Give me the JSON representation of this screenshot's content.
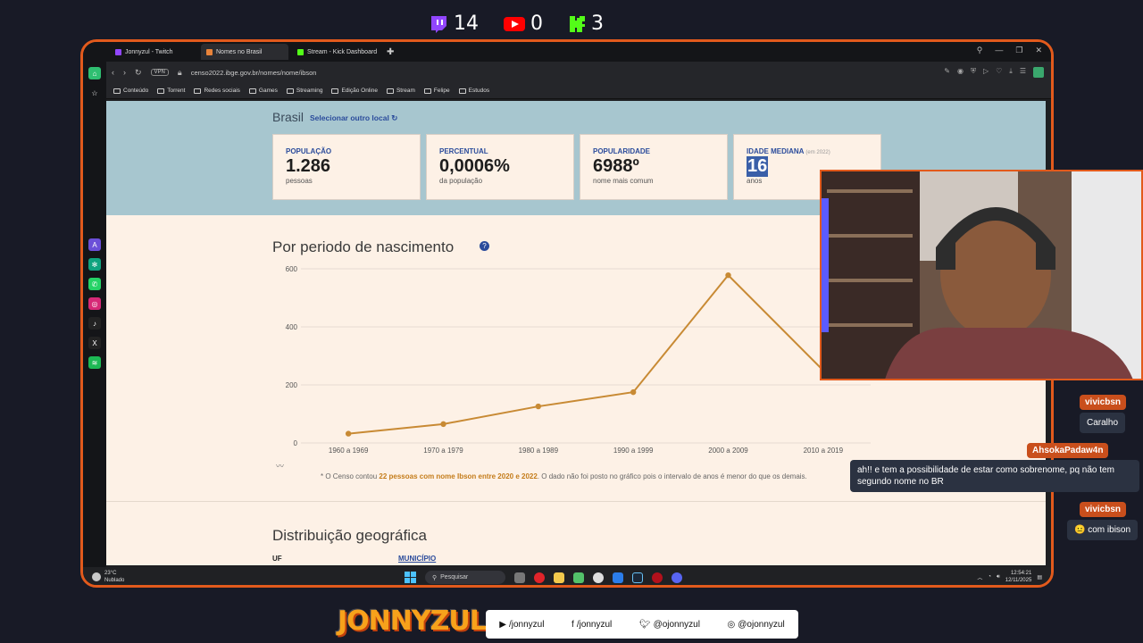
{
  "overlay": {
    "twitch_count": "14",
    "youtube_count": "0",
    "kick_count": "3"
  },
  "browser": {
    "tabs": [
      {
        "label": "Jonnyzul - Twitch",
        "color": "#9146ff"
      },
      {
        "label": "Nomes no Brasil",
        "color": "#e8833a"
      },
      {
        "label": "Stream - Kick Dashboard",
        "color": "#53fc18"
      }
    ],
    "vpn_label": "VPN",
    "url": "censo2022.ibge.gov.br/nomes/nome/ibson",
    "bookmarks": [
      "Conteúdo",
      "Torrent",
      "Redes sociais",
      "Games",
      "Streaming",
      "Edição Online",
      "Stream",
      "Felipe",
      "Estudos"
    ]
  },
  "page": {
    "location": "Brasil",
    "select_location": "Selecionar outro local",
    "cards": [
      {
        "label": "POPULAÇÃO",
        "value": "1.286",
        "sub": "pessoas"
      },
      {
        "label": "PERCENTUAL",
        "value": "0,0006%",
        "sub": "da população"
      },
      {
        "label": "POPULARIDADE",
        "value": "6988º",
        "sub": "nome mais comum"
      },
      {
        "label": "IDADE MEDIANA",
        "label_note": "(em 2022)",
        "value": "16",
        "sub": "anos"
      }
    ],
    "section_title": "Por periodo de nascimento",
    "footnote_pre": "* O Censo contou ",
    "footnote_bold": "22 pessoas com nome Ibson entre 2020 e 2022",
    "footnote_post": ". O dado não foi posto no gráfico pois o intervalo de anos é menor do que os demais.",
    "section2_title": "Distribuição geográfica",
    "col_uf": "UF",
    "col_municipio": "MUNICÍPIO"
  },
  "chart_data": {
    "type": "line",
    "categories": [
      "1960 a 1969",
      "1970 a 1979",
      "1980 a 1989",
      "1990 a 1999",
      "2000 a 2009",
      "2010 a 2019"
    ],
    "values": [
      32,
      65,
      126,
      175,
      578,
      250
    ],
    "yticks": [
      0,
      200,
      400,
      600
    ],
    "ylim": [
      0,
      600
    ],
    "color": "#c88a34",
    "grid": true
  },
  "taskbar": {
    "temp": "23°C",
    "weather": "Nublado",
    "search": "Pesquisar",
    "time": "12:54:21",
    "date": "12/11/2025"
  },
  "chat": [
    {
      "user": "vivicbsn",
      "text": "Caralho"
    },
    {
      "user": "AhsokaPadaw4n",
      "text": "ah!! e tem a possibilidade de estar como sobrenome, pq não tem segundo nome no BR"
    },
    {
      "user": "vivicbsn",
      "text": "com ibison"
    }
  ],
  "footer": {
    "brand": "JONNYZUL",
    "youtube": "/jonnyzul",
    "facebook": "/jonnyzul",
    "twitter": "@ojonnyzul",
    "instagram": "@ojonnyzul"
  }
}
